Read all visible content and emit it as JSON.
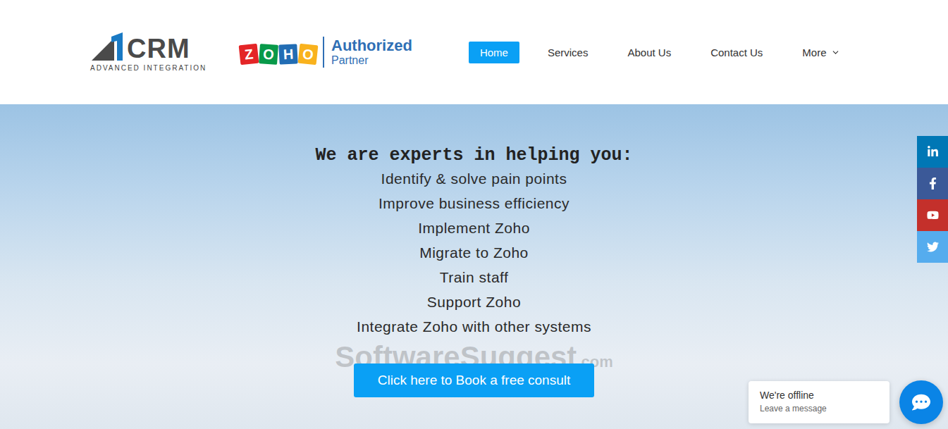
{
  "logo": {
    "name": "CRM",
    "tagline": "ADVANCED INTEGRATION"
  },
  "partner": {
    "letters": [
      {
        "char": "Z",
        "color": "#e42527"
      },
      {
        "char": "O",
        "color": "#089949"
      },
      {
        "char": "H",
        "color": "#226db4"
      },
      {
        "char": "O",
        "color": "#f9b21d"
      }
    ],
    "title": "Authorized",
    "subtitle": "Partner"
  },
  "nav": [
    {
      "label": "Home",
      "selected": true,
      "dropdown": false
    },
    {
      "label": "Services",
      "selected": false,
      "dropdown": false
    },
    {
      "label": "About Us",
      "selected": false,
      "dropdown": false
    },
    {
      "label": "Contact Us",
      "selected": false,
      "dropdown": false
    },
    {
      "label": "More",
      "selected": false,
      "dropdown": true
    }
  ],
  "hero": {
    "heading": "We are experts in helping you:",
    "items": [
      "Identify & solve pain points",
      "Improve business efficiency",
      "Implement Zoho",
      "Migrate to Zoho",
      "Train staff",
      "Support Zoho",
      "Integrate Zoho with other systems"
    ],
    "button": "Click here to Book a free consult"
  },
  "watermark": {
    "name": "SoftwareSuggest",
    "suffix": ".com"
  },
  "social": [
    {
      "kind": "linkedin",
      "color": "#0077b5"
    },
    {
      "kind": "facebook",
      "color": "#3b5998"
    },
    {
      "kind": "youtube",
      "color": "#c4302b"
    },
    {
      "kind": "twitter",
      "color": "#55acee"
    }
  ],
  "chat": {
    "status": "We're offline",
    "prompt": "Leave a message"
  }
}
